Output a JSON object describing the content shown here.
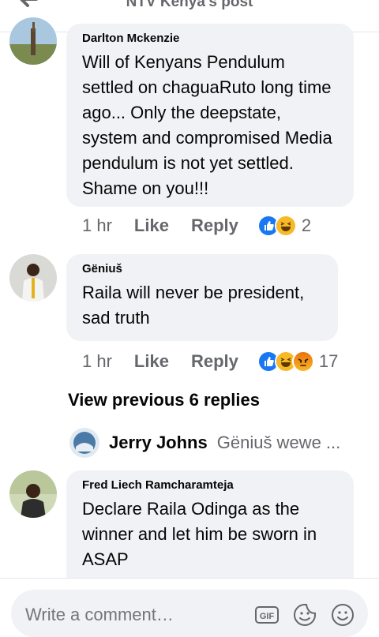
{
  "header": {
    "title": "NTV Kenya's post"
  },
  "comments": [
    {
      "author": "Darlton Mckenzie",
      "text": "Will of Kenyans Pendulum settled on chaguaRuto long time ago... Only the deepstate, system and compromised Media pendulum is not yet settled. Shame on you!!!",
      "time": "1 hr",
      "like": "Like",
      "reply": "Reply",
      "reactions": [
        "like-reaction-icon",
        "haha-reaction-icon"
      ],
      "count": "2"
    },
    {
      "author": "Gëniuš",
      "text": "Raila will never be president, sad truth",
      "time": "1 hr",
      "like": "Like",
      "reply": "Reply",
      "reactions": [
        "like-reaction-icon",
        "haha-reaction-icon",
        "angry-reaction-icon"
      ],
      "count": "17"
    },
    {
      "author": "Fred Liech Ramcharamteja",
      "text": "Declare Raila Odinga as the winner and let him be sworn in ASAP"
    }
  ],
  "replies": {
    "view_previous": "View previous 6 replies",
    "preview_author": "Jerry Johns",
    "preview_text": "Gëniuš wewe ..."
  },
  "composer": {
    "placeholder": "Write a comment…",
    "gif_label": "GIF",
    "icons": [
      "gif-icon",
      "sticker-icon",
      "emoji-icon"
    ]
  },
  "colors": {
    "bubble": "#f0f2f5",
    "meta_text": "#65676b",
    "like_blue": "#1877f2",
    "haha_yellow": "#f7b928",
    "angry_orange": "#e9710f"
  }
}
